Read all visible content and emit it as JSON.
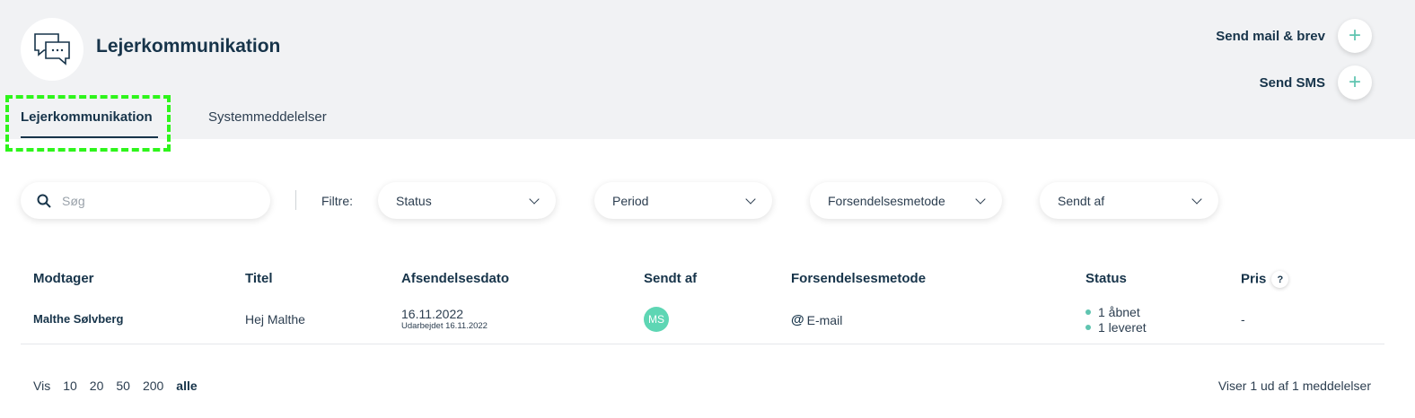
{
  "header": {
    "title": "Lejerkommunikation",
    "actions": [
      {
        "label": "Send mail & brev",
        "icon": "plus-icon"
      },
      {
        "label": "Send SMS",
        "icon": "plus-icon"
      }
    ],
    "logo_icon": "chat-bubbles-icon"
  },
  "tabs": [
    {
      "label": "Lejerkommunikation",
      "active": true
    },
    {
      "label": "Systemmeddelelser",
      "active": false
    }
  ],
  "filters": {
    "search_placeholder": "Søg",
    "label": "Filtre:",
    "dropdowns": [
      "Status",
      "Period",
      "Forsendelsesmetode",
      "Sendt af"
    ]
  },
  "table": {
    "columns": [
      "Modtager",
      "Titel",
      "Afsendelsesdato",
      "Sendt af",
      "Forsendelsesmetode",
      "Status",
      "Pris"
    ],
    "help_badge": "?",
    "rows": [
      {
        "recipient": "Malthe Sølvberg",
        "title": "Hej Malthe",
        "date": "16.11.2022",
        "date_sub": "Udarbejdet 16.11.2022",
        "sender_initials": "MS",
        "method_symbol": "@",
        "method": "E-mail",
        "status": [
          "1 åbnet",
          "1 leveret"
        ],
        "price": "-"
      }
    ]
  },
  "pagination": {
    "label": "Vis",
    "sizes": [
      "10",
      "20",
      "50",
      "200",
      "alle"
    ],
    "active": "alle",
    "summary": "Viser 1 ud af 1 meddelelser"
  },
  "colors": {
    "accent": "#5fc4b0",
    "navy": "#17344a",
    "header_bg": "#f1f2f4",
    "highlight": "#2ef51b",
    "avatar": "#5ed6b4"
  }
}
